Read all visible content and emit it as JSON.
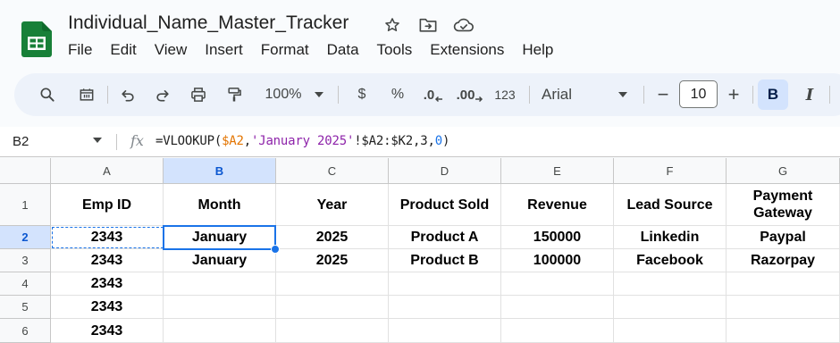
{
  "app": {
    "doc_title": "Individual_Name_Master_Tracker",
    "accent_color": "#0b57d0",
    "logo_color": "#188038",
    "title_icons": [
      "star-icon",
      "move-to-folder-icon",
      "cloud-saved-icon"
    ]
  },
  "menu": [
    "File",
    "Edit",
    "View",
    "Insert",
    "Format",
    "Data",
    "Tools",
    "Extensions",
    "Help"
  ],
  "toolbar": {
    "zoom": "100%",
    "currency": "$",
    "percent": "%",
    "decrease_decimal": ".0",
    "increase_decimal": ".00",
    "number_format": "123",
    "font": "Arial",
    "font_size": "10",
    "minus": "−",
    "plus": "+",
    "bold": "B",
    "italic": "I",
    "icons": [
      "search-icon",
      "paint-format-icon",
      "undo-icon",
      "redo-icon",
      "print-icon",
      "paint-format-roller-icon",
      "font-dropdown-icon"
    ]
  },
  "formula_bar": {
    "name_box": "B2",
    "fx": "fx",
    "formula_prefix": "=VLOOKUP(",
    "formula_ref1": "$A2",
    "formula_comma1": ",",
    "formula_str": "'January 2025'",
    "formula_range": "!$A2:$K2,3,",
    "formula_num": "0",
    "formula_suffix": ")"
  },
  "sheet": {
    "selected_cell": "B2",
    "columns": [
      "A",
      "B",
      "C",
      "D",
      "E",
      "F",
      "G"
    ],
    "rows": [
      "1",
      "2",
      "3",
      "4",
      "5",
      "6"
    ],
    "cells": [
      [
        "Emp ID",
        "Month",
        "Year",
        "Product Sold",
        "Revenue",
        "Lead Source",
        "Payment Gateway"
      ],
      [
        "2343",
        "January",
        "2025",
        "Product A",
        "150000",
        "Linkedin",
        "Paypal"
      ],
      [
        "2343",
        "January",
        "2025",
        "Product B",
        "100000",
        "Facebook",
        "Razorpay"
      ],
      [
        "2343",
        "",
        "",
        "",
        "",
        "",
        ""
      ],
      [
        "2343",
        "",
        "",
        "",
        "",
        "",
        ""
      ],
      [
        "2343",
        "",
        "",
        "",
        "",
        "",
        ""
      ]
    ]
  }
}
